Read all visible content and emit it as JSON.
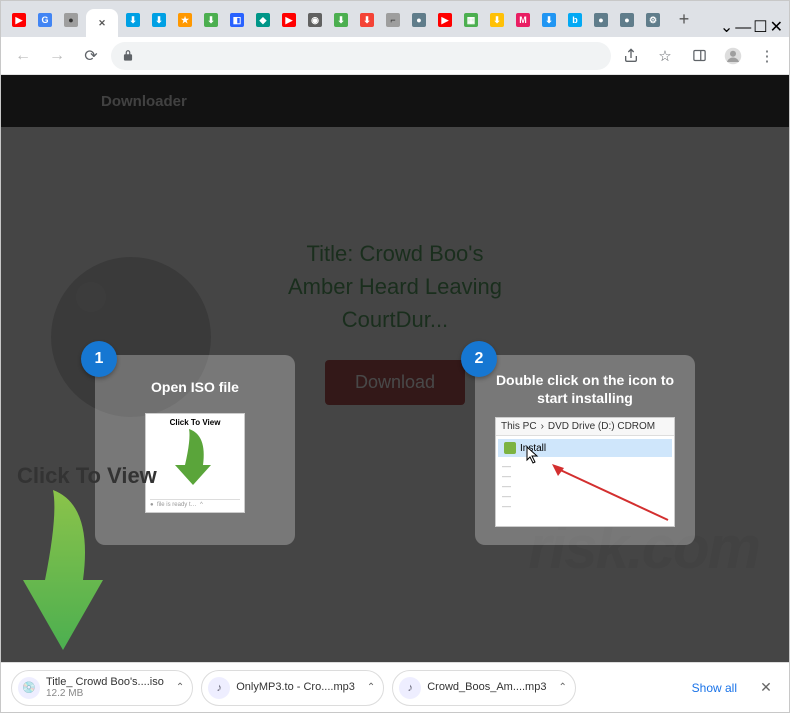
{
  "window_controls": {
    "dropdown": "⌄",
    "minimize": "—",
    "maximize": "☐",
    "close": "✕"
  },
  "tabs": [
    {
      "color": "#ff0000",
      "glyph": "▶"
    },
    {
      "color": "#4285f4",
      "glyph": "G"
    },
    {
      "color": "#9e9e9e",
      "glyph": "●"
    },
    {
      "color": "#ffffff",
      "glyph": "✕",
      "active": true
    },
    {
      "color": "#00a0e4",
      "glyph": "⬇"
    },
    {
      "color": "#00a0e4",
      "glyph": "⬇"
    },
    {
      "color": "#ff9800",
      "glyph": "★"
    },
    {
      "color": "#4caf50",
      "glyph": "⬇"
    },
    {
      "color": "#2962ff",
      "glyph": "◧"
    },
    {
      "color": "#009688",
      "glyph": "◆"
    },
    {
      "color": "#ff0000",
      "glyph": "▶"
    },
    {
      "color": "#616161",
      "glyph": "◉"
    },
    {
      "color": "#4caf50",
      "glyph": "⬇"
    },
    {
      "color": "#f44336",
      "glyph": "⬇"
    },
    {
      "color": "#9e9e9e",
      "glyph": "⌐"
    },
    {
      "color": "#607d8b",
      "glyph": "●"
    },
    {
      "color": "#ff0000",
      "glyph": "▶"
    },
    {
      "color": "#4caf50",
      "glyph": "▦"
    },
    {
      "color": "#ffc107",
      "glyph": "⬇"
    },
    {
      "color": "#e91e63",
      "glyph": "M"
    },
    {
      "color": "#2196f3",
      "glyph": "⬇"
    },
    {
      "color": "#03a9f4",
      "glyph": "b"
    },
    {
      "color": "#607d8b",
      "glyph": "●"
    },
    {
      "color": "#607d8b",
      "glyph": "●"
    },
    {
      "color": "#607d8b",
      "glyph": "⚙"
    }
  ],
  "page": {
    "header": "Downloader",
    "title_prefix": "Title: ",
    "title_lines": [
      "Crowd Boo's",
      "Amber Heard Leaving",
      "CourtDur..."
    ],
    "download_btn": "Download",
    "watermark": "risk.com",
    "click_to_view": "Click To View"
  },
  "overlay": {
    "step1": {
      "num": "1",
      "title": "Open ISO file",
      "thumb_label": "Click To View"
    },
    "step2": {
      "num": "2",
      "title": "Double click on the icon to start installing",
      "breadcrumb": [
        "This PC",
        "DVD Drive (D:) CDROM"
      ],
      "item": "Install"
    }
  },
  "shelf": {
    "items": [
      {
        "name": "Title_ Crowd Boo's....iso",
        "size": "12.2 MB",
        "kind": "iso"
      },
      {
        "name": "OnlyMP3.to - Cro....mp3",
        "size": "",
        "kind": "mp3"
      },
      {
        "name": "Crowd_Boos_Am....mp3",
        "size": "",
        "kind": "mp3"
      }
    ],
    "show_all": "Show all"
  }
}
